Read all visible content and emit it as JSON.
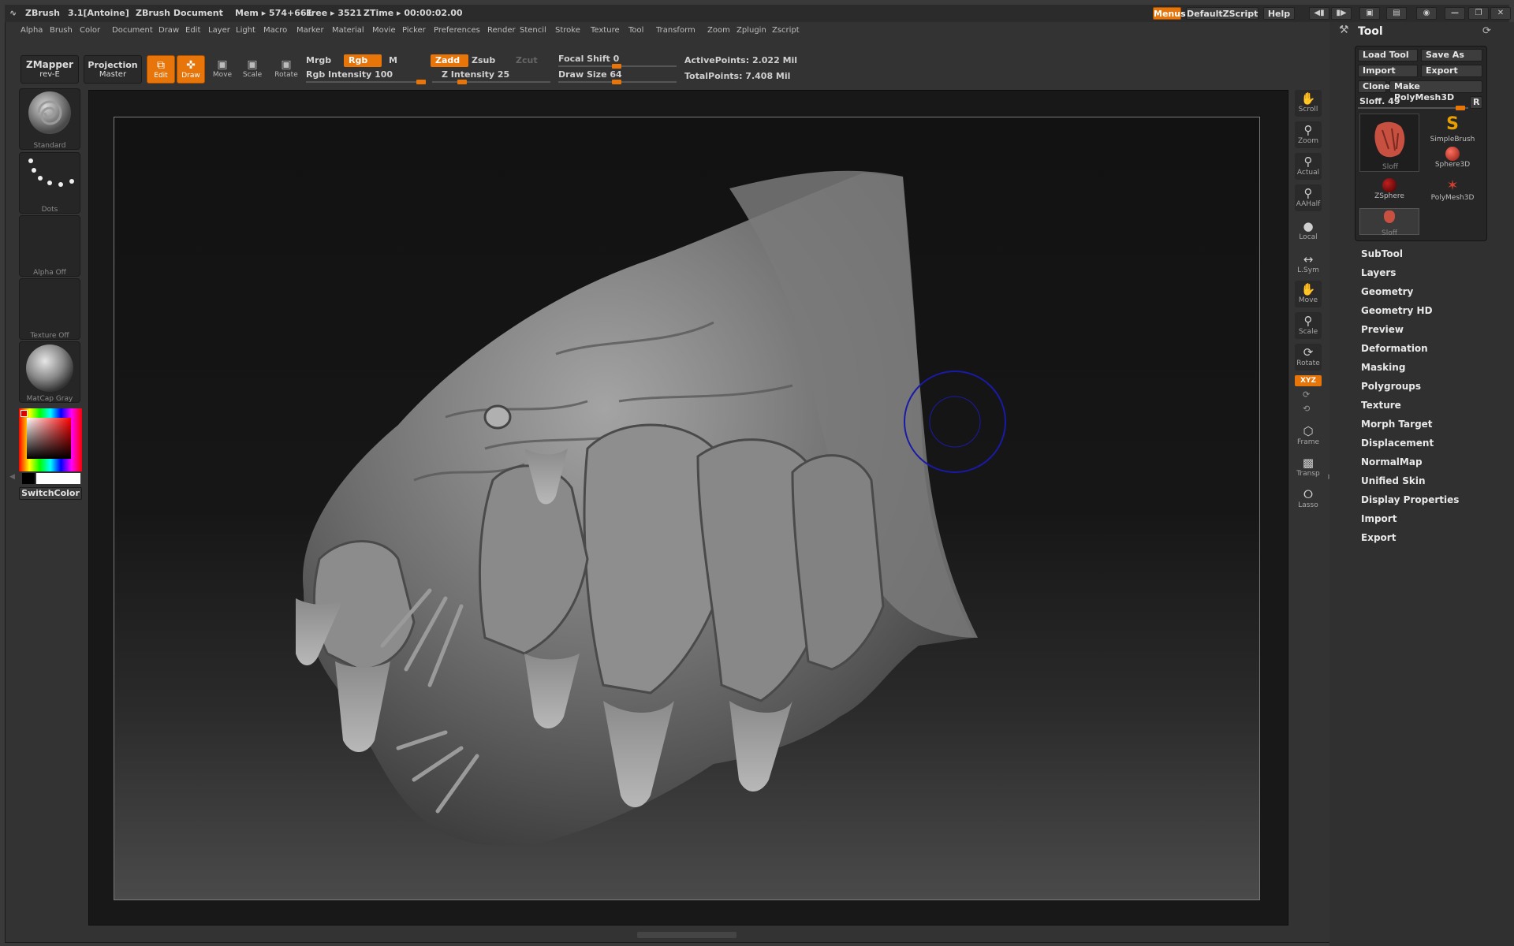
{
  "titlebar": {
    "app": "ZBrush",
    "version": "3.1[Antoine]",
    "document": "ZBrush Document",
    "mem": "Mem ▸ 574+661",
    "free": "Free ▸ 3521",
    "ztime": "ZTime ▸ 00:00:02.00",
    "menus_btn": "Menus",
    "script_btn": "DefaultZScript",
    "help_btn": "Help"
  },
  "menubar": [
    "Alpha",
    "Brush",
    "Color",
    "Document",
    "Draw",
    "Edit",
    "Layer",
    "Light",
    "Macro",
    "Marker",
    "Material",
    "Movie",
    "Picker",
    "Preferences",
    "Render",
    "Stencil",
    "Stroke",
    "Texture",
    "Tool",
    "Transform",
    "Zoom",
    "Zplugin",
    "Zscript"
  ],
  "shelf": {
    "zmapper": "ZMapper",
    "zmapper_sub": "rev-E",
    "projection": "Projection",
    "projection_sub": "Master",
    "edit": "Edit",
    "draw": "Draw",
    "move": "Move",
    "scale": "Scale",
    "rotate": "Rotate",
    "mrgb": "Mrgb",
    "rgb": "Rgb",
    "m": "M",
    "rgb_intensity": "Rgb Intensity 100",
    "zadd": "Zadd",
    "zsub": "Zsub",
    "zcut": "Zcut",
    "z_intensity": "Z Intensity 25",
    "focal_shift": "Focal Shift 0",
    "draw_size": "Draw Size 64",
    "active_points": "ActivePoints: 2.022 Mil",
    "total_points": "TotalPoints: 7.408 Mil"
  },
  "left": {
    "brush": "Standard",
    "stroke": "Dots",
    "alpha": "Alpha Off",
    "texture": "Texture Off",
    "material": "MatCap Gray",
    "switch_color": "SwitchColor"
  },
  "right_shelf": [
    "Scroll",
    "Zoom",
    "Actual",
    "AAHalf",
    "Local",
    "L.Sym",
    "Move",
    "Scale",
    "Rotate",
    "XYZ",
    "Frame",
    "Transp",
    "Lasso"
  ],
  "tool": {
    "title": "Tool",
    "load_tool": "Load Tool",
    "save_as": "Save As",
    "import": "Import",
    "export": "Export",
    "clone": "Clone",
    "make_polymesh": "Make PolyMesh3D",
    "sloff_value": "Sloff. 49",
    "r_btn": "R",
    "items": [
      "Sloff",
      "SimpleBrush",
      "Sphere3D",
      "ZSphere",
      "PolyMesh3D",
      "Sloff"
    ],
    "subpalettes": [
      "SubTool",
      "Layers",
      "Geometry",
      "Geometry HD",
      "Preview",
      "Deformation",
      "Masking",
      "Polygroups",
      "Texture",
      "Morph Target",
      "Displacement",
      "NormalMap",
      "Unified Skin",
      "Display Properties",
      "Import",
      "Export"
    ]
  }
}
